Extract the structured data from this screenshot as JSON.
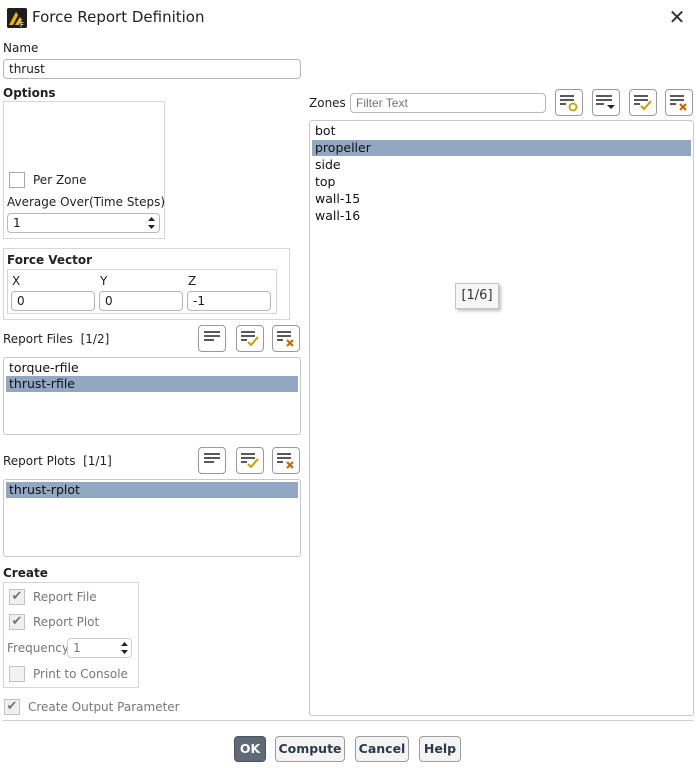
{
  "window": {
    "title": "Force Report Definition",
    "close_label": "✕"
  },
  "name": {
    "label": "Name",
    "value": "thrust"
  },
  "options": {
    "label": "Options",
    "per_zone_label": "Per Zone",
    "average_label": "Average Over(Time Steps)",
    "average_value": "1"
  },
  "force_vector": {
    "label": "Force Vector",
    "x_label": "X",
    "y_label": "Y",
    "z_label": "Z",
    "x_value": "0",
    "y_value": "0",
    "z_value": "-1"
  },
  "report_files": {
    "label": "Report Files",
    "count": "[1/2]",
    "items": [
      "torque-rfile",
      "thrust-rfile"
    ]
  },
  "report_plots": {
    "label": "Report Plots",
    "count": "[1/1]",
    "items": [
      "thrust-rplot"
    ]
  },
  "create": {
    "label": "Create",
    "report_file_label": "Report File",
    "report_plot_label": "Report Plot",
    "frequency_label": "Frequency",
    "frequency_value": "1",
    "print_console_label": "Print to Console"
  },
  "create_output_param_label": "Create Output Parameter",
  "zones": {
    "label": "Zones",
    "filter_placeholder": "Filter Text",
    "items": [
      "bot",
      "propeller",
      "side",
      "top",
      "wall-15",
      "wall-16"
    ],
    "tooltip": "[1/6]"
  },
  "buttons": {
    "ok": "OK",
    "compute": "Compute",
    "cancel": "Cancel",
    "help": "Help"
  },
  "colors": {
    "selection": "#92a8c2",
    "primary_button": "#5f6a76"
  }
}
